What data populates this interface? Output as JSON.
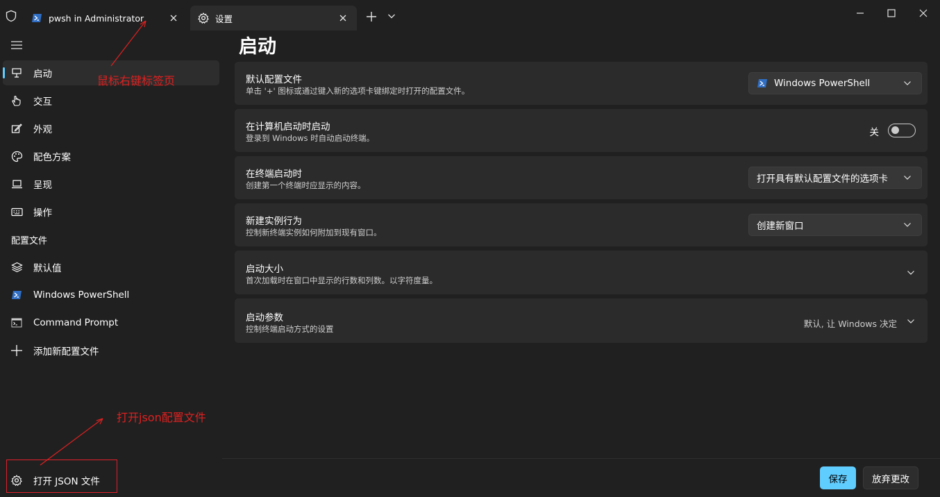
{
  "tabs": [
    {
      "label": "pwsh in Administrator",
      "icon": "powershell-icon"
    },
    {
      "label": "设置",
      "icon": "gear-icon"
    }
  ],
  "sidebar": {
    "items": [
      {
        "label": "启动",
        "icon": "monitor-stand-icon"
      },
      {
        "label": "交互",
        "icon": "hand-pointer-icon"
      },
      {
        "label": "外观",
        "icon": "pen-edit-icon"
      },
      {
        "label": "配色方案",
        "icon": "palette-icon"
      },
      {
        "label": "呈现",
        "icon": "laptop-icon"
      },
      {
        "label": "操作",
        "icon": "keyboard-icon"
      }
    ],
    "profiles_heading": "配置文件",
    "profiles": [
      {
        "label": "默认值",
        "icon": "layers-icon"
      },
      {
        "label": "Windows PowerShell",
        "icon": "powershell-icon"
      },
      {
        "label": "Command Prompt",
        "icon": "cmd-icon"
      },
      {
        "label": "添加新配置文件",
        "icon": "plus-icon"
      }
    ],
    "open_json": "打开 JSON 文件"
  },
  "annotations": {
    "tab_hint": "鼠标右键标签页",
    "json_hint": "打开json配置文件"
  },
  "main": {
    "title": "启动",
    "settings": [
      {
        "title": "默认配置文件",
        "desc": "单击 '+' 图标或通过键入新的选项卡键绑定时打开的配置文件。",
        "value": "Windows PowerShell"
      },
      {
        "title": "在计算机启动时启动",
        "desc": "登录到 Windows 时自动启动终端。",
        "value": "关"
      },
      {
        "title": "在终端启动时",
        "desc": "创建第一个终端时应显示的内容。",
        "value": "打开具有默认配置文件的选项卡"
      },
      {
        "title": "新建实例行为",
        "desc": "控制新终端实例如何附加到现有窗口。",
        "value": "创建新窗口"
      },
      {
        "title": "启动大小",
        "desc": "首次加载时在窗口中显示的行数和列数。以字符度量。"
      },
      {
        "title": "启动参数",
        "desc": "控制终端启动方式的设置",
        "value": "默认, 让 Windows 决定"
      }
    ]
  },
  "footer": {
    "save": "保存",
    "discard": "放弃更改"
  },
  "colors": {
    "accent": "#60cdff",
    "annotation": "#e02020",
    "background": "#202020",
    "card": "#2b2b2b"
  }
}
